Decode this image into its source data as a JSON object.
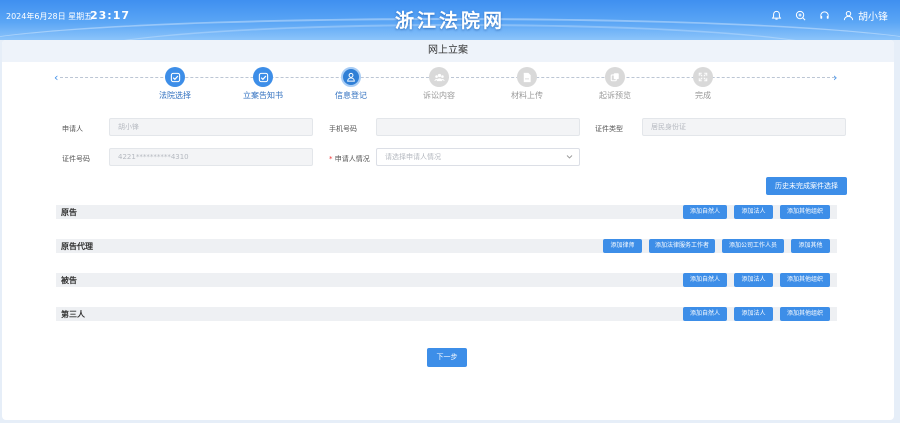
{
  "header": {
    "date": "2024年6月28日 星期五",
    "time": "23:17",
    "title": "浙江法院网",
    "user": "胡小锋",
    "icons": [
      "bell-icon",
      "zoom-icon",
      "headset-icon",
      "user-icon"
    ]
  },
  "page": {
    "title": "网上立案"
  },
  "steps": [
    {
      "label": "法院选择",
      "state": "done"
    },
    {
      "label": "立案告知书",
      "state": "done"
    },
    {
      "label": "信息登记",
      "state": "active"
    },
    {
      "label": "诉讼内容",
      "state": "todo"
    },
    {
      "label": "材料上传",
      "state": "todo"
    },
    {
      "label": "起诉预览",
      "state": "todo"
    },
    {
      "label": "完成",
      "state": "todo"
    }
  ],
  "form": {
    "applicant_label": "申请人",
    "applicant_value": "胡小锋",
    "phone_label": "手机号码",
    "phone_value": "",
    "id_type_label": "证件类型",
    "id_type_value": "居民身份证",
    "id_no_label": "证件号码",
    "id_no_value": "4221**********4310",
    "situation_required": "*",
    "situation_label": "申请人情况",
    "situation_placeholder": "请选择申请人情况"
  },
  "history_button": "历史未完成案件选择",
  "sections": {
    "plaintiff": {
      "title": "原告",
      "buttons": [
        "添加自然人",
        "添加法人",
        "添加其他组织"
      ]
    },
    "agent": {
      "title": "原告代理",
      "buttons": [
        "添加律师",
        "添加法律服务工作者",
        "添加公司工作人员",
        "添加其他"
      ]
    },
    "defendant": {
      "title": "被告",
      "buttons": [
        "添加自然人",
        "添加法人",
        "添加其他组织"
      ]
    },
    "third": {
      "title": "第三人",
      "buttons": [
        "添加自然人",
        "添加法人",
        "添加其他组织"
      ]
    }
  },
  "next_button": "下一步",
  "colors": {
    "primary": "#3d8ee8",
    "header_top": "#3f8ff0",
    "step_todo": "#d9d9d9"
  }
}
